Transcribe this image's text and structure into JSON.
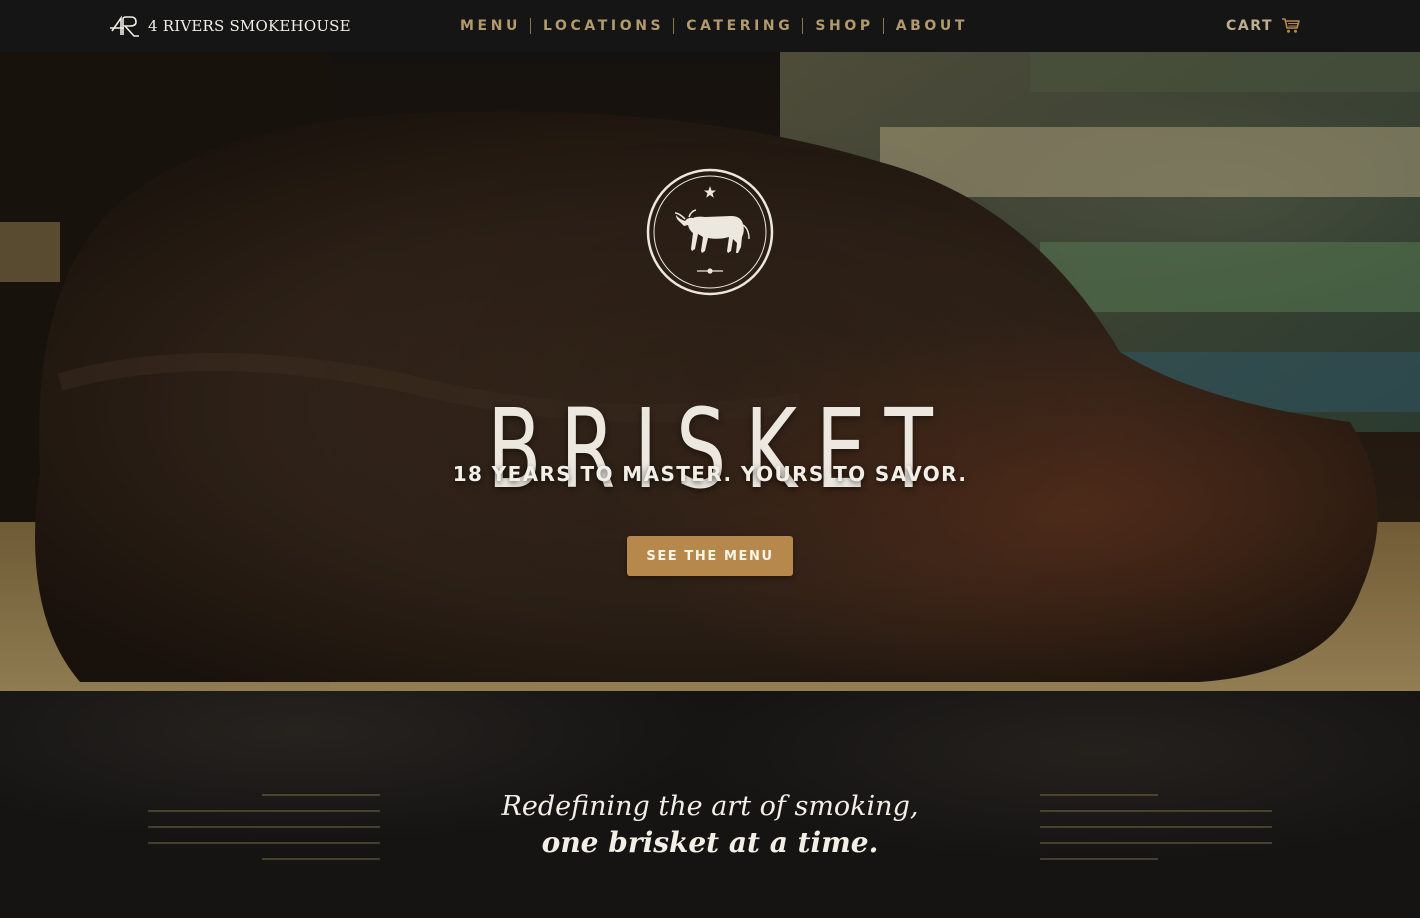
{
  "header": {
    "brand_name": "4 RIVERS SMOKEHOUSE",
    "brand_monogram": "4R",
    "nav": [
      {
        "label": "MENU"
      },
      {
        "label": "LOCATIONS"
      },
      {
        "label": "CATERING"
      },
      {
        "label": "SHOP"
      },
      {
        "label": "ABOUT"
      }
    ],
    "cart_label": "CART",
    "cart_icon": "shopping-cart-icon"
  },
  "hero": {
    "emblem_icon": "bull-emblem-icon",
    "title": "BRISKET",
    "tagline": "18 YEARS TO MASTER. YOURS TO SAVOR.",
    "cta_label": "SEE THE MENU",
    "background": "smoked-brisket-photo"
  },
  "intro": {
    "line1": "Redefining the art of smoking,",
    "line2": "one brisket at a time."
  },
  "colors": {
    "nav_bar": "#151515",
    "nav_text": "#b39a6b",
    "accent_gold": "#b7884b",
    "hero_text": "#ece8e0",
    "intro_bg": "#151413"
  }
}
